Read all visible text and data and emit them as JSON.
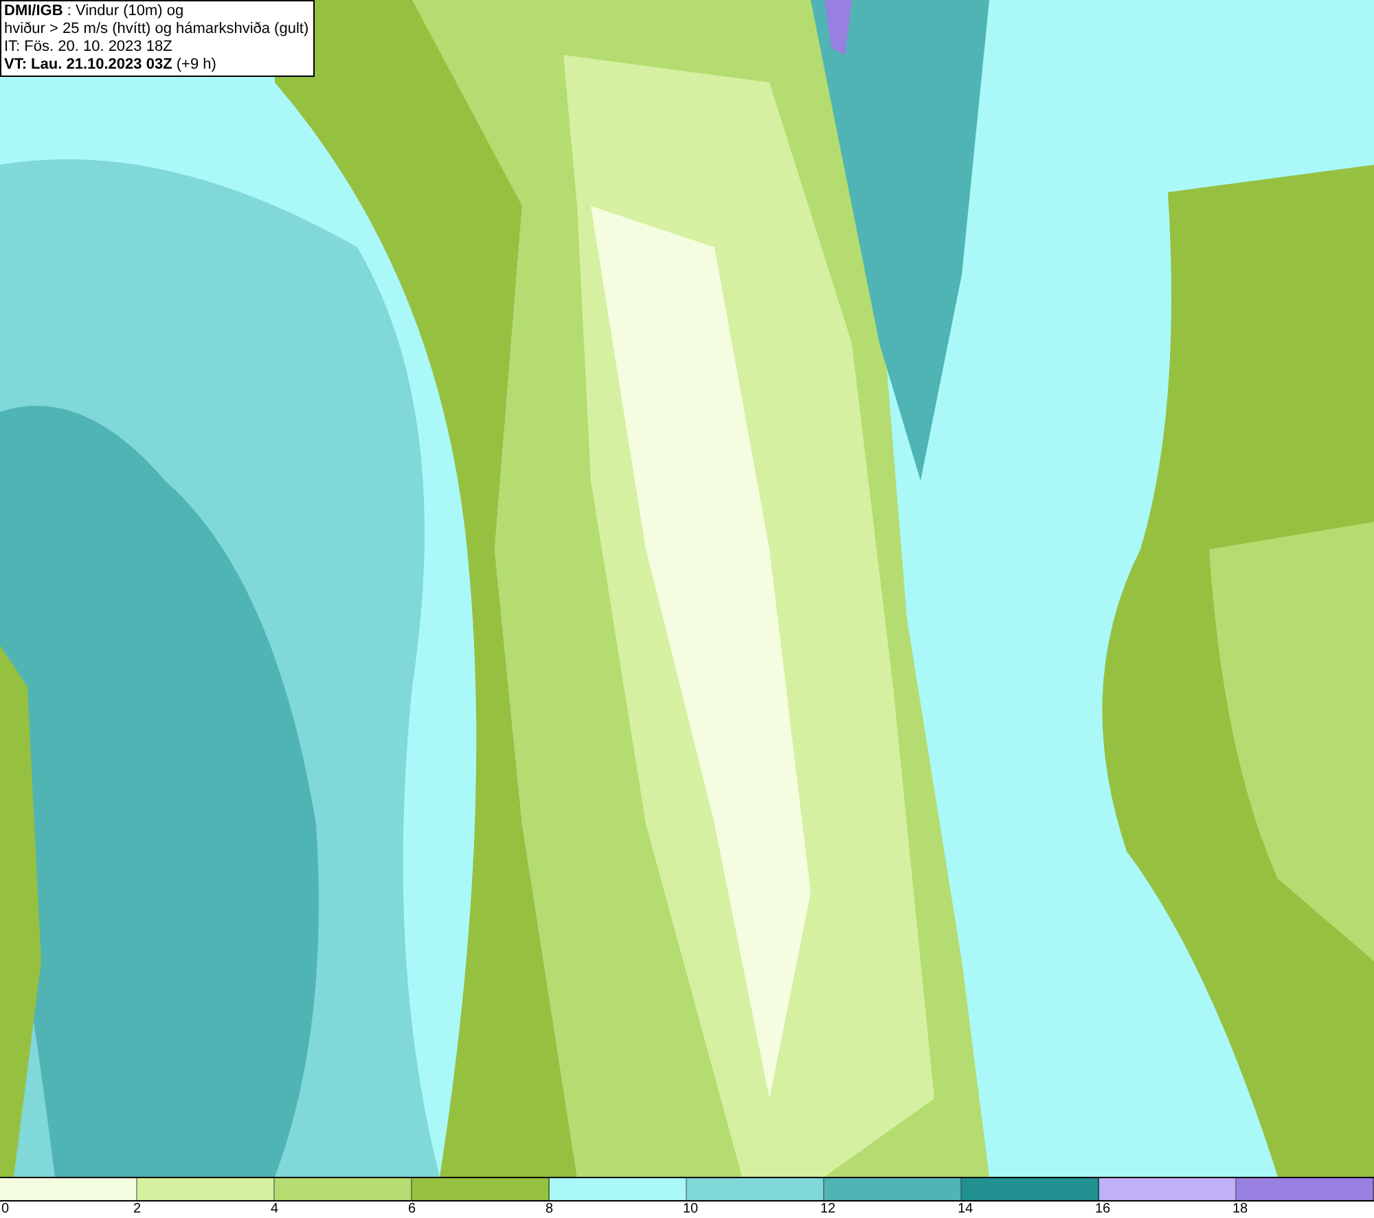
{
  "title_box": {
    "lines": [
      "**DMI/IGB** : Vindur (10m) og",
      "hviður > 25 m/s (hvítt) og hámarkshviða (gult)",
      "IT: Fös. 20. 10. 2023 18Z",
      "**VT: Lau. 21.10.2023 03Z** (+9 h)"
    ]
  },
  "legend": {
    "segments": [
      {
        "color": "#f5fde0"
      },
      {
        "color": "#d4f0a0"
      },
      {
        "color": "#b4dc70"
      },
      {
        "color": "#96c040"
      },
      {
        "color": "#aaf8f8"
      },
      {
        "color": "#80d8d8"
      },
      {
        "color": "#50b4b4"
      },
      {
        "color": "#209090"
      },
      {
        "color": "#c0b0f8"
      },
      {
        "color": "#9880e0"
      }
    ],
    "ticks": [
      "0",
      "2",
      "4",
      "6",
      "8",
      "10",
      "12",
      "14",
      "16",
      "18"
    ]
  }
}
